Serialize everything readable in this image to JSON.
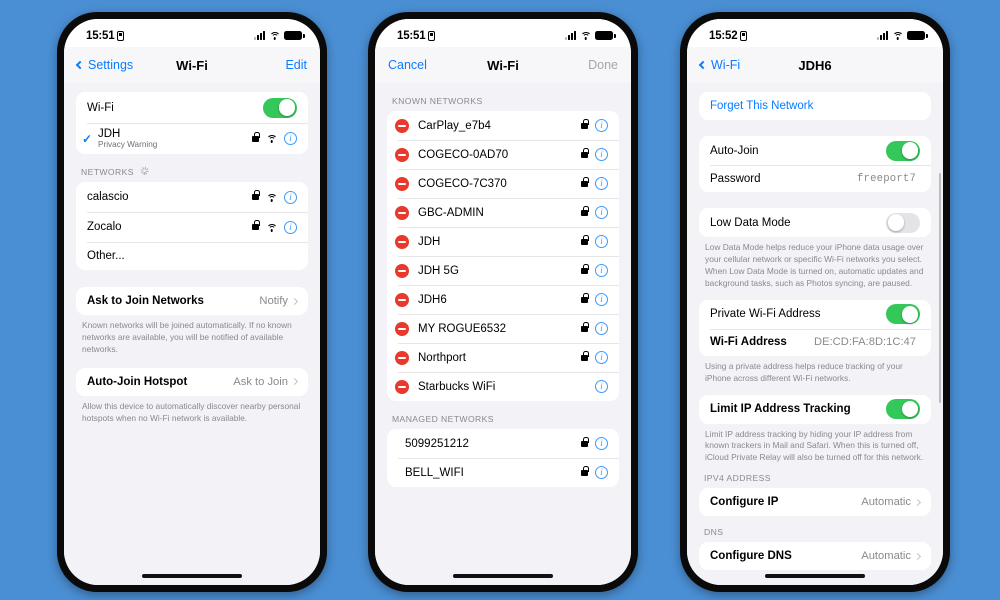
{
  "background_color": "#4a8fd4",
  "accent_blue": "#0a7cff",
  "toggle_green": "#34c759",
  "delete_red": "#e8392c",
  "phone1": {
    "status": {
      "time": "15:51",
      "record_icon": "record-icon",
      "signal_icon": "cellular-signal-icon",
      "wifi_icon": "wifi-icon",
      "battery_icon": "battery-icon"
    },
    "nav": {
      "back_label": "Settings",
      "title": "Wi-Fi",
      "action_label": "Edit"
    },
    "wifi_toggle": {
      "label": "Wi-Fi",
      "state": "on"
    },
    "connected": {
      "name": "JDH",
      "subtitle": "Privacy Warning",
      "checked": true,
      "lock": true,
      "wifi": true,
      "info": true
    },
    "networks_header": "NETWORKS",
    "networks": [
      {
        "name": "calascio",
        "lock": true,
        "wifi": true,
        "info": true
      },
      {
        "name": "Zocalo",
        "lock": true,
        "wifi": true,
        "info": true
      },
      {
        "name": "Other...",
        "lock": false,
        "wifi": false,
        "info": false
      }
    ],
    "ask_to_join": {
      "label": "Ask to Join Networks",
      "value": "Notify"
    },
    "ask_to_join_footer": "Known networks will be joined automatically. If no known networks are available, you will be notified of available networks.",
    "auto_join_hotspot": {
      "label": "Auto-Join Hotspot",
      "value": "Ask to Join"
    },
    "auto_join_footer": "Allow this device to automatically discover nearby personal hotspots when no Wi-Fi network is available."
  },
  "phone2": {
    "status": {
      "time": "15:51"
    },
    "nav": {
      "back_label": "Cancel",
      "title": "Wi-Fi",
      "action_label": "Done"
    },
    "known_header": "KNOWN NETWORKS",
    "known_networks": [
      {
        "name": "CarPlay_e7b4",
        "lock": true
      },
      {
        "name": "COGECO-0AD70",
        "lock": true
      },
      {
        "name": "COGECO-7C370",
        "lock": true
      },
      {
        "name": "GBC-ADMIN",
        "lock": true
      },
      {
        "name": "JDH",
        "lock": true
      },
      {
        "name": "JDH 5G",
        "lock": true
      },
      {
        "name": "JDH6",
        "lock": true
      },
      {
        "name": "MY ROGUE6532",
        "lock": true
      },
      {
        "name": "Northport",
        "lock": true
      },
      {
        "name": "Starbucks WiFi",
        "lock": false
      }
    ],
    "managed_header": "MANAGED NETWORKS",
    "managed_networks": [
      {
        "name": "5099251212",
        "lock": true
      },
      {
        "name": "BELL_WIFI",
        "lock": true
      }
    ]
  },
  "phone3": {
    "status": {
      "time": "15:52"
    },
    "nav": {
      "back_label": "Wi-Fi",
      "title": "JDH6"
    },
    "forget_label": "Forget This Network",
    "auto_join": {
      "label": "Auto-Join",
      "state": "on"
    },
    "password": {
      "label": "Password",
      "value": "freeport7"
    },
    "low_data_mode": {
      "label": "Low Data Mode",
      "state": "off"
    },
    "low_data_footer": "Low Data Mode helps reduce your iPhone data usage over your cellular network or specific Wi-Fi networks you select. When Low Data Mode is turned on, automatic updates and background tasks, such as Photos syncing, are paused.",
    "private_address": {
      "label": "Private Wi-Fi Address",
      "state": "on"
    },
    "wifi_address": {
      "label": "Wi-Fi Address",
      "value": "DE:CD:FA:8D:1C:47"
    },
    "private_footer": "Using a private address helps reduce tracking of your iPhone across different Wi-Fi networks.",
    "limit_ip": {
      "label": "Limit IP Address Tracking",
      "state": "on"
    },
    "limit_ip_footer": "Limit IP address tracking by hiding your IP address from known trackers in Mail and Safari. When this is turned off, iCloud Private Relay will also be turned off for this network.",
    "ipv4_header": "IPV4 ADDRESS",
    "configure_ip": {
      "label": "Configure IP",
      "value": "Automatic"
    },
    "dns_header": "DNS",
    "configure_dns": {
      "label": "Configure DNS",
      "value": "Automatic"
    }
  }
}
